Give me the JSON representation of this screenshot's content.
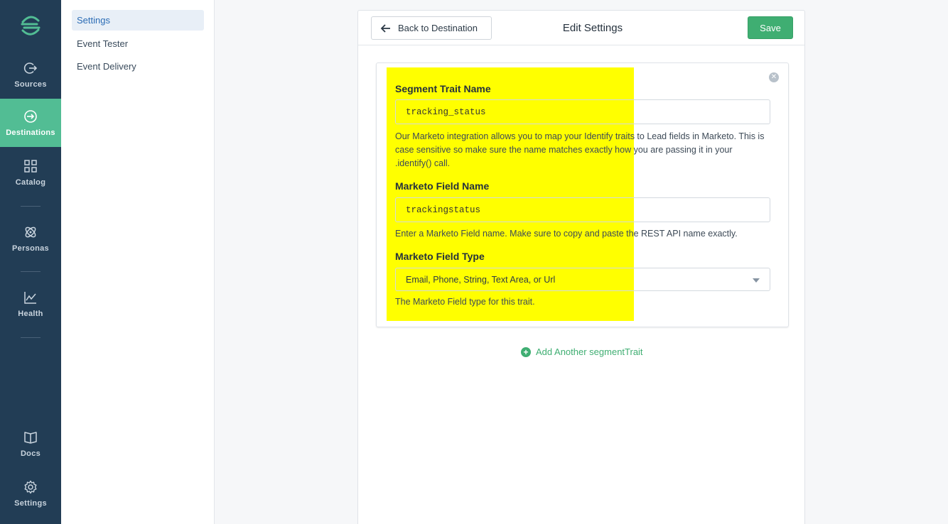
{
  "nav": {
    "items": [
      {
        "label": "Sources",
        "icon": "sources-icon"
      },
      {
        "label": "Destinations",
        "icon": "destinations-icon"
      },
      {
        "label": "Catalog",
        "icon": "catalog-icon"
      },
      {
        "label": "Personas",
        "icon": "personas-icon"
      },
      {
        "label": "Health",
        "icon": "health-icon"
      },
      {
        "label": "Docs",
        "icon": "docs-icon"
      },
      {
        "label": "Settings",
        "icon": "gear-icon"
      }
    ],
    "active": "Destinations"
  },
  "subnav": {
    "items": [
      {
        "label": "Settings"
      },
      {
        "label": "Event Tester"
      },
      {
        "label": "Event Delivery"
      }
    ],
    "active": "Settings"
  },
  "header": {
    "back_label": "Back to Destination",
    "title": "Edit Settings",
    "save_label": "Save"
  },
  "trait": {
    "trait_label": "Segment Trait Name",
    "trait_value": "tracking_status",
    "trait_help": "Our Marketo integration allows you to map your Identify traits to Lead fields in Marketo. This is case sensitive so make sure the name matches exactly how you are passing it in your .identify() call.",
    "field_label": "Marketo Field Name",
    "field_value": "trackingstatus",
    "field_help": "Enter a Marketo Field name. Make sure to copy and paste the REST API name exactly.",
    "type_label": "Marketo Field Type",
    "type_value": "Email, Phone, String, Text Area, or Url",
    "type_help": "The Marketo Field type for this trait."
  },
  "add_label": "Add Another segmentTrait",
  "colors": {
    "rail_bg": "#223d55",
    "accent_green": "#3fae72",
    "active_nav": "#52bd94",
    "highlight": "#ffff00",
    "link_blue": "#2b6cb5"
  }
}
